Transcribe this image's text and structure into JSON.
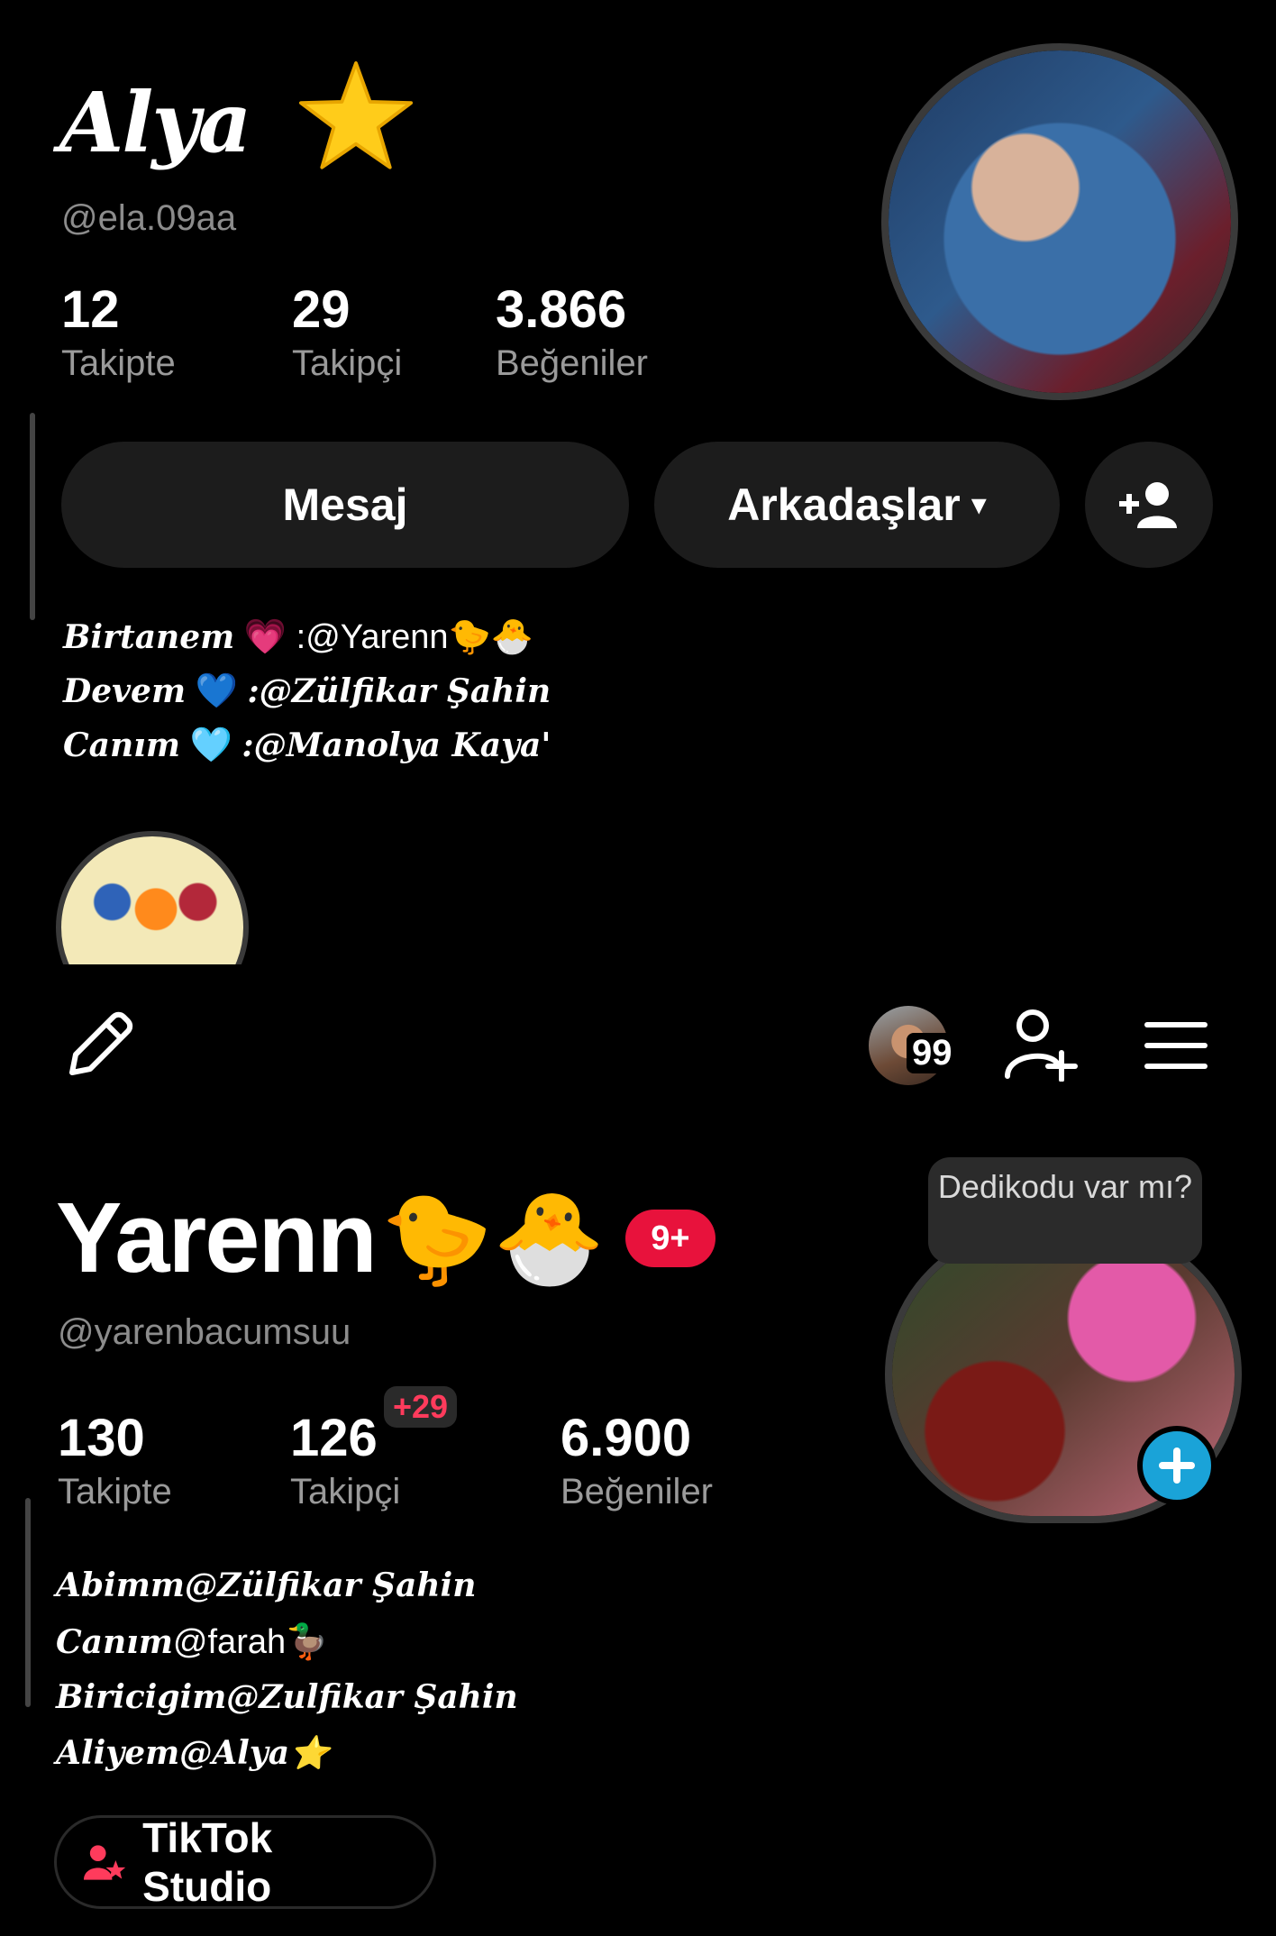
{
  "profile1": {
    "display_name": "Alya",
    "name_emoji": "star",
    "handle": "@ela.09aa",
    "stats": [
      {
        "value": "12",
        "label": "Takipte"
      },
      {
        "value": "29",
        "label": "Takipçi"
      },
      {
        "value": "3.866",
        "label": "Beğeniler"
      }
    ],
    "buttons": {
      "message": "Mesaj",
      "friends": "Arkadaşlar",
      "friends_caret": "▾",
      "add_friend_icon": "add-friend-icon"
    },
    "bio": [
      {
        "prefix": "Birtanem",
        "emoji": "💗",
        "text": ":@Yarenn🐤🐣"
      },
      {
        "prefix": "Devem",
        "emoji": "💙",
        "text": ":@Zülfikar Şahin"
      },
      {
        "prefix": "Canım",
        "emoji": "🩵",
        "text": ":@Manolya Kaya'"
      }
    ]
  },
  "toolbar": {
    "edit_icon": "pencil-icon",
    "visitor_count": "99",
    "add_friend_icon": "add-user-icon",
    "menu_icon": "hamburger-menu-icon"
  },
  "profile2": {
    "display_name": "Yarenn",
    "name_emojis": "🐤🐣",
    "notification_badge": "9+",
    "handle": "@yarenbacumsuu",
    "stats": [
      {
        "value": "130",
        "label": "Takipte"
      },
      {
        "value": "126",
        "label": "Takipçi",
        "delta": "+29"
      },
      {
        "value": "6.900",
        "label": "Beğeniler"
      }
    ],
    "tooltip": "Dedikodu var mı?",
    "bio": [
      {
        "prefix": "Abimm",
        "text": "@Zülfikar Şahin"
      },
      {
        "prefix": "Canım",
        "text": "@farah🦆"
      },
      {
        "prefix": "Biricigim",
        "text": "@Zulfikar Şahin"
      },
      {
        "prefix": "Aliyem",
        "text": "@Alya⭐"
      }
    ],
    "studio_button": "TikTok Studio"
  },
  "colors": {
    "background": "#000000",
    "pill": "#1c1c1c",
    "badge_red": "#e8123c",
    "plus_blue": "#1aa3d8"
  }
}
